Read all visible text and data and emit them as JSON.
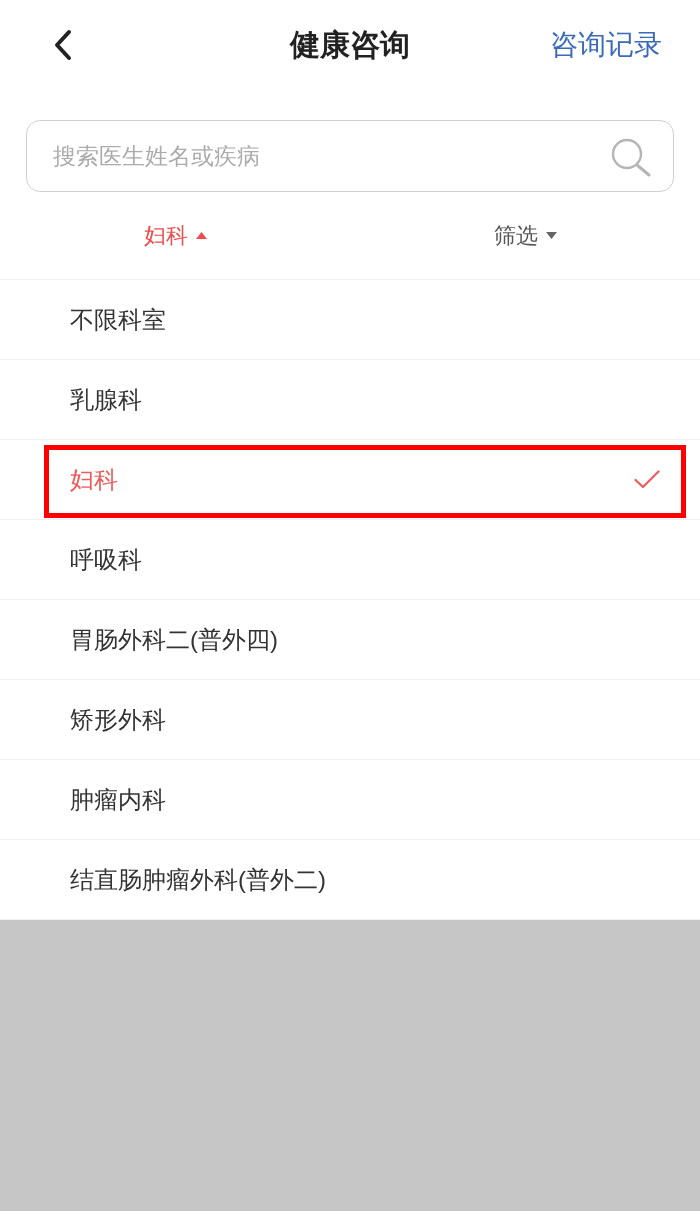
{
  "header": {
    "title": "健康咨询",
    "action": "咨询记录"
  },
  "search": {
    "placeholder": "搜索医生姓名或疾病"
  },
  "filters": [
    {
      "label": "妇科",
      "selected": true,
      "expanded": true
    },
    {
      "label": "筛选",
      "selected": false,
      "expanded": false
    }
  ],
  "departments": [
    {
      "label": "不限科室",
      "selected": false,
      "highlighted": false
    },
    {
      "label": "乳腺科",
      "selected": false,
      "highlighted": false
    },
    {
      "label": "妇科",
      "selected": true,
      "highlighted": true
    },
    {
      "label": "呼吸科",
      "selected": false,
      "highlighted": false
    },
    {
      "label": "胃肠外科二(普外四)",
      "selected": false,
      "highlighted": false
    },
    {
      "label": "矫形外科",
      "selected": false,
      "highlighted": false
    },
    {
      "label": "肿瘤内科",
      "selected": false,
      "highlighted": false
    },
    {
      "label": "结直肠肿瘤外科(普外二)",
      "selected": false,
      "highlighted": false
    }
  ]
}
